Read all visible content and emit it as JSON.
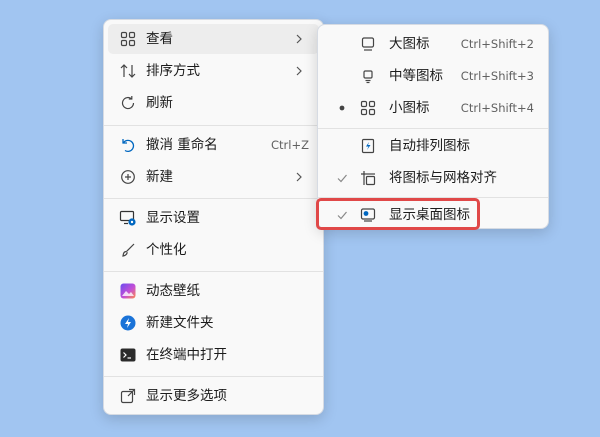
{
  "main_menu": {
    "items": [
      {
        "label": "查看",
        "icon": "grid-icon",
        "submenu": true
      },
      {
        "label": "排序方式",
        "icon": "sort-arrows-icon",
        "submenu": true
      },
      {
        "label": "刷新",
        "icon": "refresh-icon"
      },
      {
        "label": "撤消 重命名",
        "icon": "undo-icon",
        "shortcut": "Ctrl+Z"
      },
      {
        "label": "新建",
        "icon": "plus-circle-icon",
        "submenu": true
      },
      {
        "label": "显示设置",
        "icon": "display-settings-icon"
      },
      {
        "label": "个性化",
        "icon": "brush-icon"
      },
      {
        "label": "动态壁纸",
        "icon": "wallpaper-icon"
      },
      {
        "label": "新建文件夹",
        "icon": "new-folder-icon"
      },
      {
        "label": "在终端中打开",
        "icon": "terminal-icon"
      },
      {
        "label": "显示更多选项",
        "icon": "more-options-icon"
      }
    ]
  },
  "sub_menu": {
    "items": [
      {
        "label": "大图标",
        "icon": "large-icons-icon",
        "shortcut": "Ctrl+Shift+2"
      },
      {
        "label": "中等图标",
        "icon": "medium-icons-icon",
        "shortcut": "Ctrl+Shift+3"
      },
      {
        "label": "小图标",
        "icon": "small-icons-icon",
        "shortcut": "Ctrl+Shift+4",
        "selected": true
      },
      {
        "label": "自动排列图标",
        "icon": "auto-arrange-icon"
      },
      {
        "label": "将图标与网格对齐",
        "icon": "align-grid-icon",
        "checked": true
      },
      {
        "label": "显示桌面图标",
        "icon": "show-desktop-icons-icon",
        "checked": true
      }
    ]
  },
  "colors": {
    "desktop_background": "#a1c5f1",
    "highlight_border": "#e04848",
    "accent": "#0067c0"
  }
}
